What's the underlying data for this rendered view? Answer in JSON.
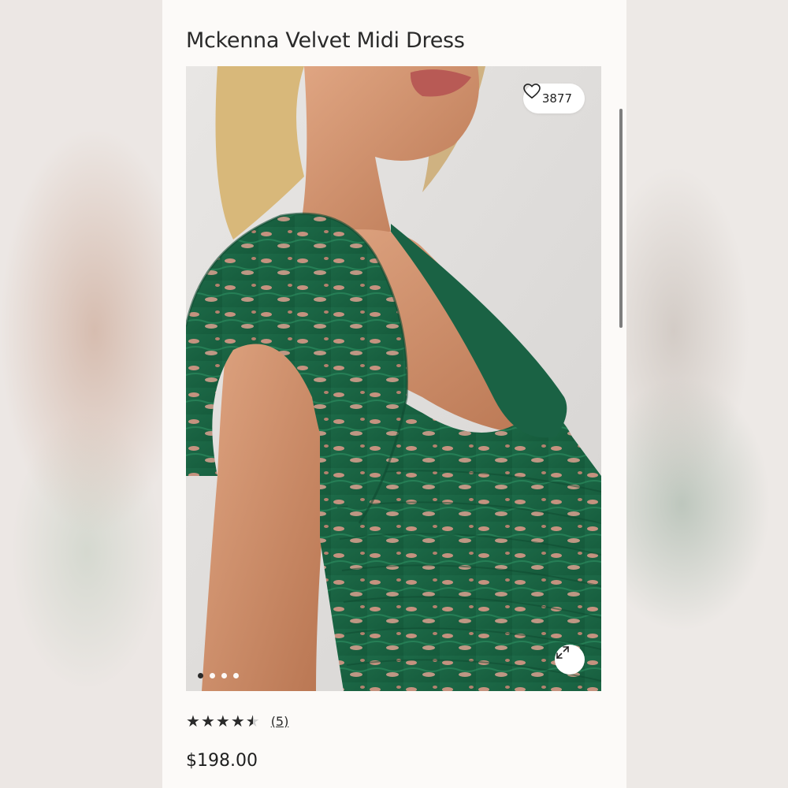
{
  "product": {
    "title": "Mckenna Velvet Midi Dress",
    "favorites_count": "3877",
    "rating": 4.5,
    "rating_max": 5,
    "review_count_label": "(5)",
    "price": "$198.00"
  },
  "gallery": {
    "image_count": 4,
    "active_index": 0,
    "icons": {
      "favorite": "heart-outline-icon",
      "expand": "expand-arrows-icon"
    }
  },
  "colors": {
    "dress_green": "#1f6b4a",
    "print_pink": "#e39a8a",
    "panel_bg": "#fcfaf8"
  }
}
